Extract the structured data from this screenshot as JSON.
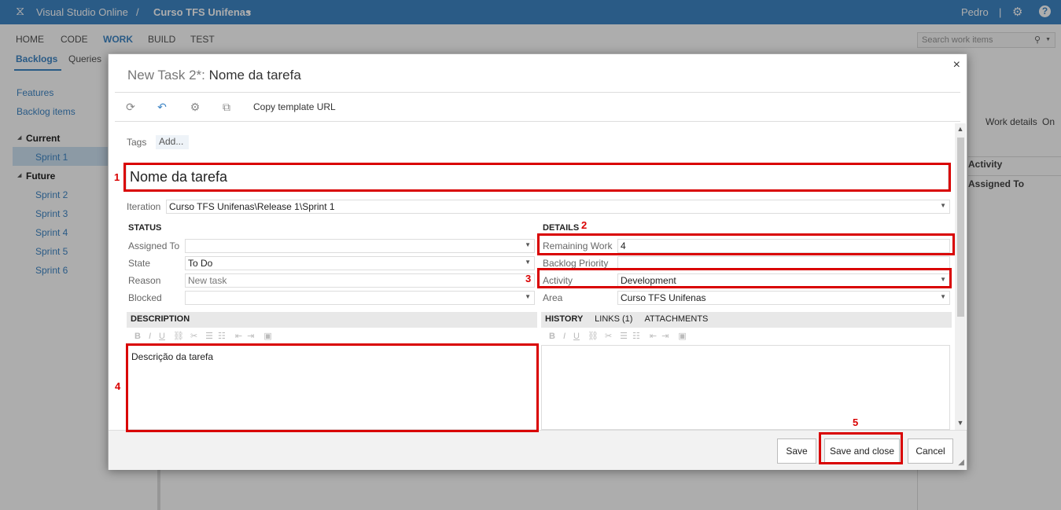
{
  "topbar": {
    "product": "Visual Studio Online",
    "separator": "/",
    "project": "Curso TFS Unifenas",
    "user": "Pedro",
    "divider": "|"
  },
  "nav": {
    "items": [
      "HOME",
      "CODE",
      "WORK",
      "BUILD",
      "TEST"
    ],
    "active": "WORK",
    "subtabs": [
      "Backlogs",
      "Queries"
    ],
    "search_placeholder": "Search work items"
  },
  "sidebar": {
    "links": [
      "Features",
      "Backlog items"
    ],
    "current_label": "Current",
    "current_sprints": [
      "Sprint 1"
    ],
    "future_label": "Future",
    "future_sprints": [
      "Sprint 2",
      "Sprint 3",
      "Sprint 4",
      "Sprint 5",
      "Sprint 6"
    ]
  },
  "rightpanel": {
    "work_details_label": "Work details",
    "work_details_value": "On",
    "col1": "Activity",
    "col2": "Assigned To"
  },
  "dialog": {
    "title_prefix": "New Task 2*:",
    "title_name": "Nome da tarefa",
    "close": "×",
    "toolbar_copy": "Copy template URL",
    "tags_label": "Tags",
    "tags_add": "Add...",
    "title_value": "Nome da tarefa",
    "iteration_label": "Iteration",
    "iteration_value": "Curso TFS Unifenas\\Release 1\\Sprint 1",
    "status_heading": "STATUS",
    "assigned_label": "Assigned To",
    "assigned_value": "",
    "state_label": "State",
    "state_value": "To Do",
    "reason_label": "Reason",
    "reason_value": "New task",
    "blocked_label": "Blocked",
    "blocked_value": "",
    "details_heading": "DETAILS",
    "remaining_label": "Remaining Work",
    "remaining_value": "4",
    "priority_label": "Backlog Priority",
    "priority_value": "",
    "activity_label": "Activity",
    "activity_value": "Development",
    "area_label": "Area",
    "area_value": "Curso TFS Unifenas",
    "description_tab": "DESCRIPTION",
    "description_value": "Descrição da tarefa",
    "history_tab": "HISTORY",
    "links_tab": "LINKS (1)",
    "attachments_tab": "ATTACHMENTS",
    "save": "Save",
    "save_close": "Save and close",
    "cancel": "Cancel"
  },
  "annotations": [
    "1",
    "2",
    "3",
    "4",
    "5"
  ],
  "colors": {
    "accent": "#3f86c6",
    "annotation": "#d90000"
  }
}
